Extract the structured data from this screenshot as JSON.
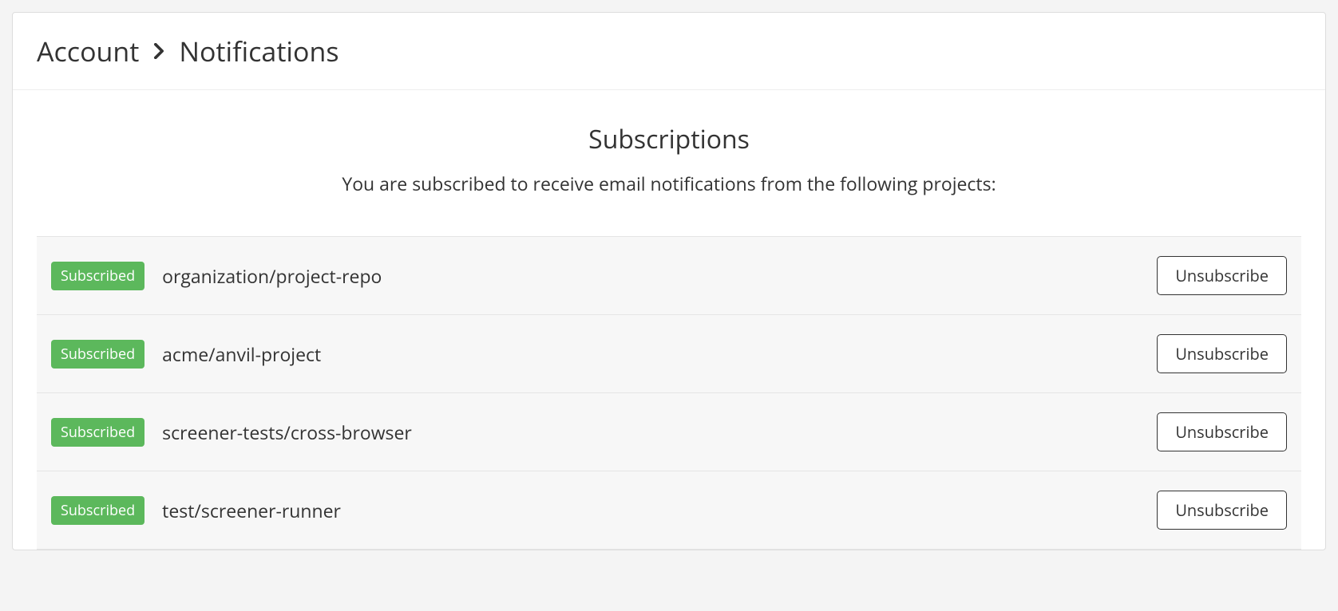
{
  "breadcrumb": {
    "parent": "Account",
    "current": "Notifications"
  },
  "section": {
    "title": "Subscriptions",
    "description": "You are subscribed to receive email notifications from the following projects:"
  },
  "badge_label": "Subscribed",
  "action_label": "Unsubscribe",
  "subscriptions": [
    {
      "project": "organization/project-repo"
    },
    {
      "project": "acme/anvil-project"
    },
    {
      "project": "screener-tests/cross-browser"
    },
    {
      "project": "test/screener-runner"
    }
  ]
}
